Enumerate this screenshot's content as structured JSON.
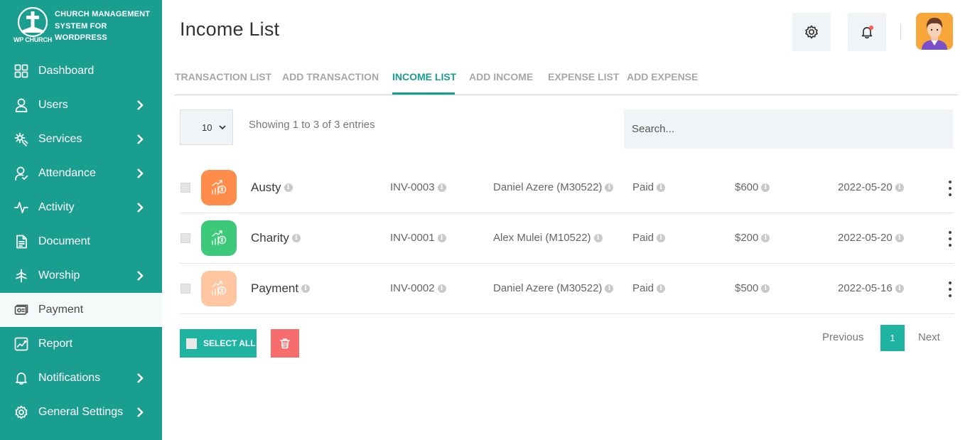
{
  "brand": {
    "logo_text": "WP CHURCH",
    "title": "CHURCH MANAGEMENT SYSTEM FOR WORDPRESS"
  },
  "sidebar": {
    "items": [
      {
        "label": "Dashboard",
        "icon": "dashboard-icon"
      },
      {
        "label": "Users",
        "icon": "user-icon",
        "has_submenu": true
      },
      {
        "label": "Services",
        "icon": "services-icon",
        "has_submenu": true
      },
      {
        "label": "Attendance",
        "icon": "attendance-icon",
        "has_submenu": true
      },
      {
        "label": "Activity",
        "icon": "activity-icon",
        "has_submenu": true
      },
      {
        "label": "Document",
        "icon": "document-icon"
      },
      {
        "label": "Worship",
        "icon": "worship-icon",
        "has_submenu": true
      },
      {
        "label": "Payment",
        "icon": "payment-icon",
        "active": true
      },
      {
        "label": "Report",
        "icon": "report-icon"
      },
      {
        "label": "Notifications",
        "icon": "bell-icon",
        "has_submenu": true
      },
      {
        "label": "General Settings",
        "icon": "gear-icon",
        "has_submenu": true
      }
    ]
  },
  "header": {
    "title": "Income List"
  },
  "tabs": [
    {
      "label": "TRANSACTION LIST"
    },
    {
      "label": "ADD TRANSACTION"
    },
    {
      "label": "INCOME LIST",
      "active": true
    },
    {
      "label": "ADD INCOME"
    },
    {
      "label": "EXPENSE LIST"
    },
    {
      "label": "ADD EXPENSE"
    }
  ],
  "controls": {
    "per_page": "10",
    "showing": "Showing 1 to 3 of 3 entries",
    "search_placeholder": "Search..."
  },
  "rows": [
    {
      "name": "Austy",
      "invoice": "INV-0003",
      "member": "Daniel Azere (M30522)",
      "status": "Paid",
      "amount": "$600",
      "date": "2022-05-20",
      "icon_color": "#ff8c4b"
    },
    {
      "name": "Charity",
      "invoice": "INV-0001",
      "member": "Alex Mulei (M10522)",
      "status": "Paid",
      "amount": "$200",
      "date": "2022-05-20",
      "icon_color": "#3cc97a"
    },
    {
      "name": "Payment",
      "invoice": "INV-0002",
      "member": "Daniel Azere (M30522)",
      "status": "Paid",
      "amount": "$500",
      "date": "2022-05-16",
      "icon_color": "#ffc6a2"
    }
  ],
  "footer": {
    "select_all": "SELECT ALL",
    "previous": "Previous",
    "page": "1",
    "next": "Next"
  },
  "colors": {
    "sidebar": "#1a9e8f",
    "accent": "#1fb4a1",
    "danger": "#f76c6c"
  }
}
